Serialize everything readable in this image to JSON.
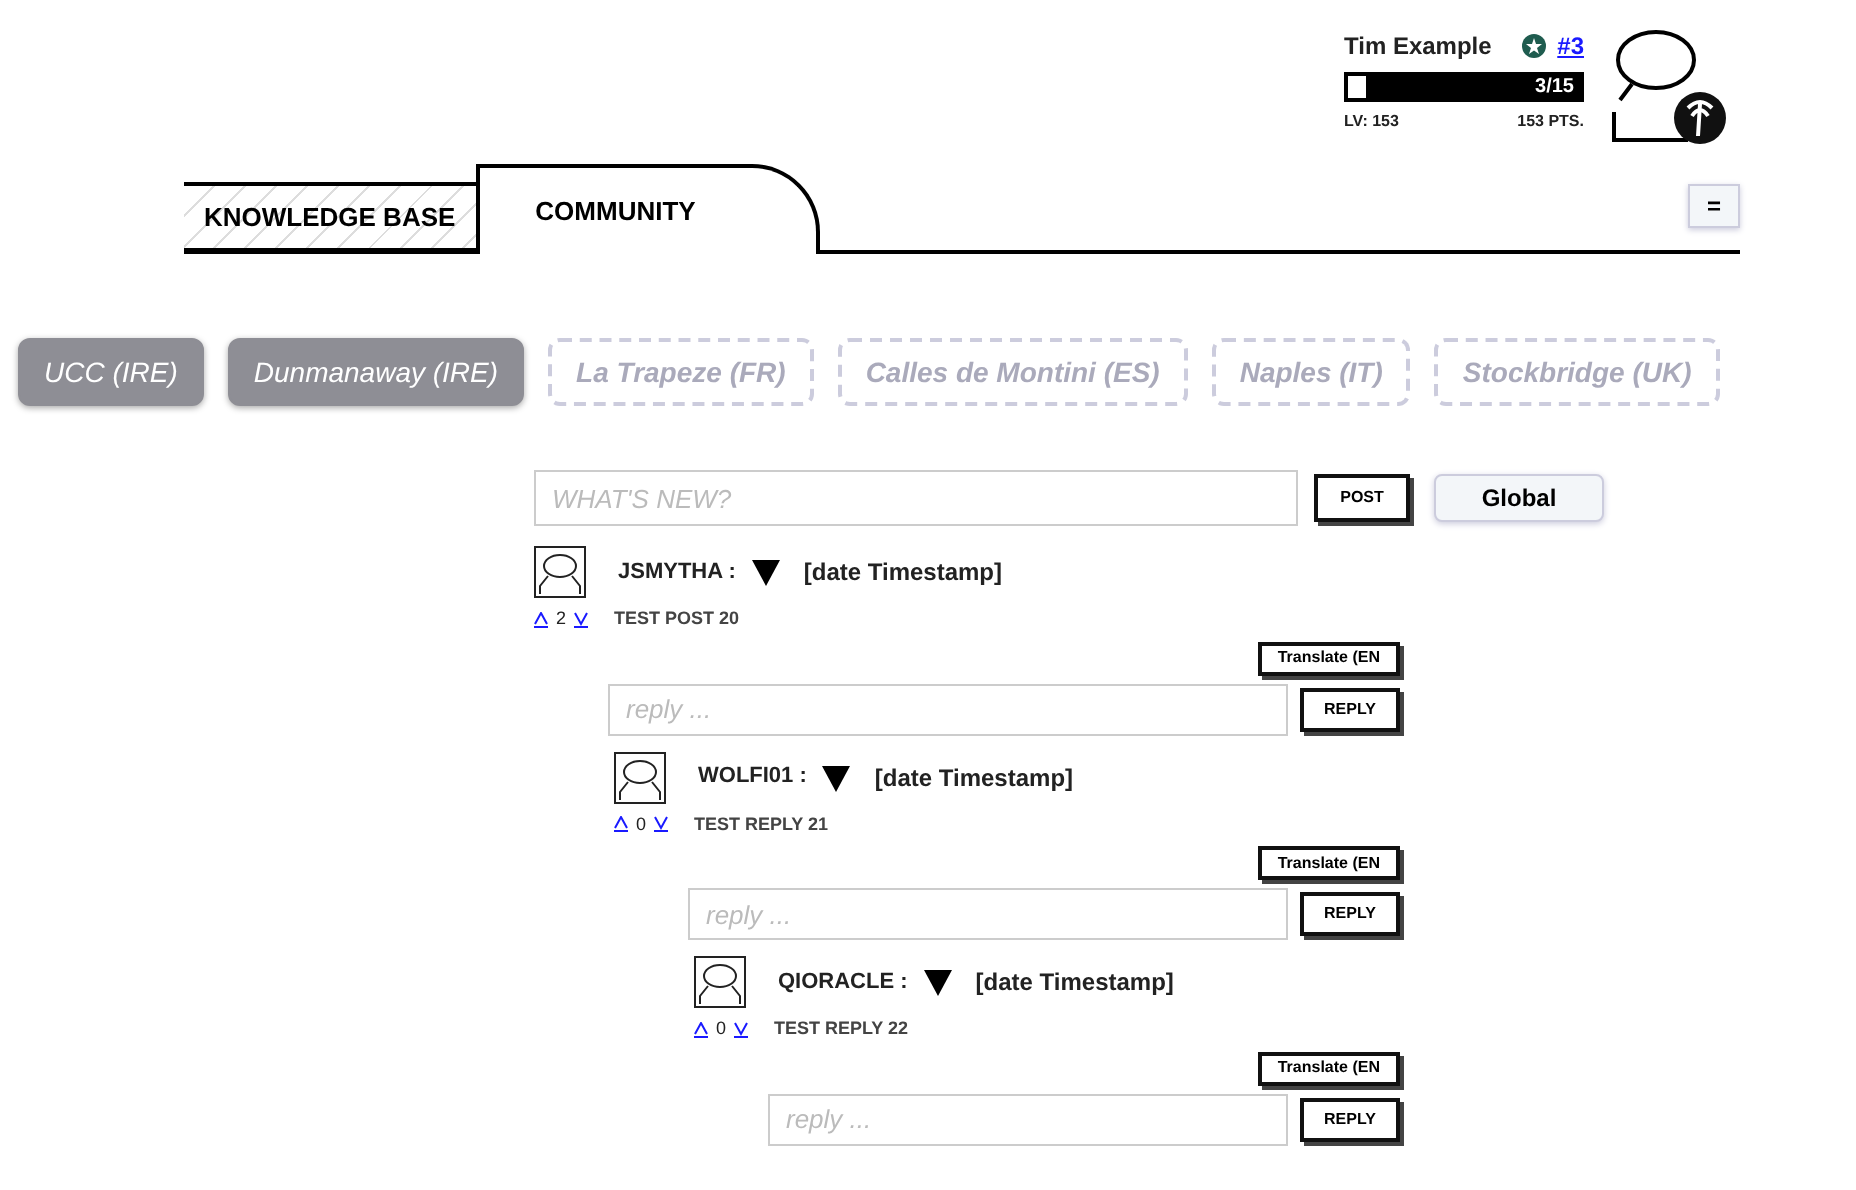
{
  "profile": {
    "name": "Tim Example",
    "rank_link": "#3",
    "progress": {
      "level": 0.08,
      "reading": "3/15"
    },
    "level_label": "LV: 153",
    "points": "153 PTS."
  },
  "tabs": [
    {
      "label": "KNOWLEDGE BASE",
      "selected": false
    },
    {
      "label": "COMMUNITY",
      "selected": true
    }
  ],
  "menu_button": "=",
  "locations": [
    {
      "label": "UCC (IRE)",
      "selected": true
    },
    {
      "label": "Dunmanaway (IRE)",
      "selected": true
    },
    {
      "label": "La Trapeze (FR)",
      "selected": false
    },
    {
      "label": "Calles de Montini (ES)",
      "selected": false
    },
    {
      "label": "Naples (IT)",
      "selected": false
    },
    {
      "label": "Stockbridge (UK)",
      "selected": false
    }
  ],
  "composer": {
    "placeholder": "WHAT'S NEW?",
    "post_button": "POST",
    "scope_button": "Global"
  },
  "posts": [
    {
      "user": "JSMYTHA :",
      "timestamp": "[date Timestamp]",
      "votes": "2",
      "body": "TEST POST 20",
      "translate": "Translate (EN",
      "reply_placeholder": "reply ...",
      "reply_button": "REPLY",
      "children": [
        {
          "user": "WOLFI01 :",
          "timestamp": "[date Timestamp]",
          "votes": "0",
          "body": "TEST REPLY 21",
          "translate": "Translate (EN",
          "reply_placeholder": "reply ...",
          "reply_button": "REPLY",
          "children": [
            {
              "user": "QIORACLE :",
              "timestamp": "[date Timestamp]",
              "votes": "0",
              "body": "TEST REPLY 22",
              "translate": "Translate (EN",
              "reply_placeholder": "reply ...",
              "reply_button": "REPLY"
            }
          ]
        }
      ]
    }
  ]
}
